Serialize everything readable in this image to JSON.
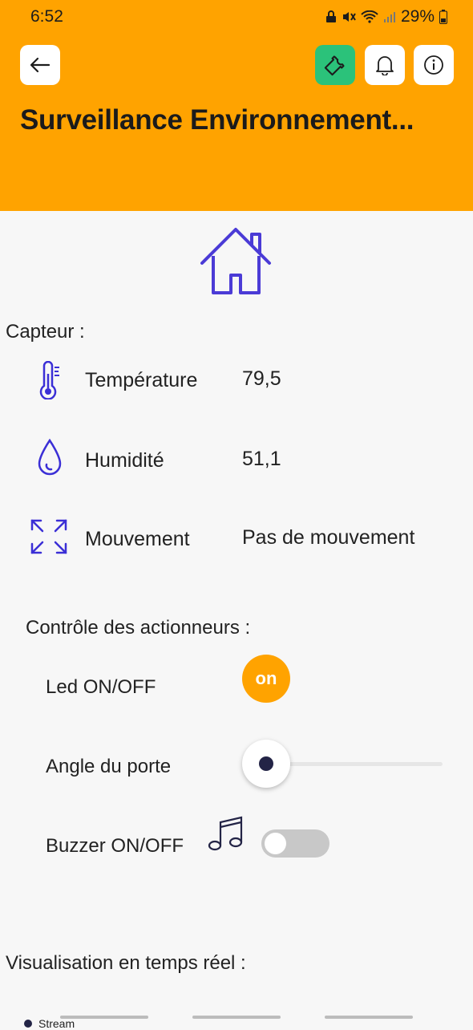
{
  "status_bar": {
    "time": "6:52",
    "battery": "29%"
  },
  "header": {
    "title": "Surveillance Environnement...",
    "back_icon": "arrow-left-icon",
    "wrench_icon": "wrench-icon",
    "bell_icon": "bell-icon",
    "info_icon": "info-icon",
    "accent": "#FFA300",
    "wrench_bg": "#2BC27A"
  },
  "sensors": {
    "heading": "Capteur :",
    "items": [
      {
        "label": "Température",
        "value": "79,5",
        "icon": "thermometer-icon"
      },
      {
        "label": "Humidité",
        "value": "51,1",
        "icon": "droplet-icon"
      },
      {
        "label": "Mouvement",
        "value": "Pas de mouvement",
        "icon": "expand-arrows-icon"
      }
    ],
    "icon_color": "#3B2FD6"
  },
  "actuators": {
    "heading": "Contrôle des actionneurs :",
    "led_label": "Led ON/OFF",
    "led_button": "on",
    "led_on": true,
    "door_label": "Angle du porte",
    "door_angle_fraction": 0,
    "buzzer_label": "Buzzer ON/OFF",
    "buzzer_icon": "music-note-icon",
    "buzzer_on": false
  },
  "visualisation": {
    "heading": "Visualisation en temps réel :",
    "legend": "Stream"
  }
}
